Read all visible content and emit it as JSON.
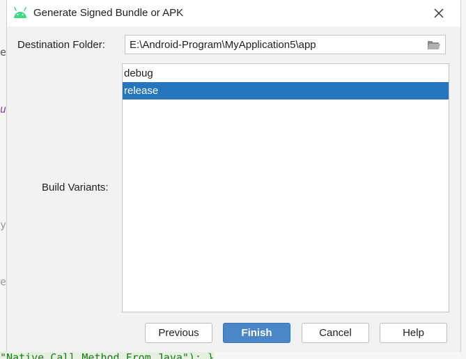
{
  "background": {
    "left_glyphs": [
      "e",
      "u",
      "y",
      "e"
    ],
    "bottom_code": "\"Native Call Method From Java\"); }"
  },
  "dialog": {
    "title": "Generate Signed Bundle or APK",
    "title_icon": "android-icon",
    "close_icon": "close-icon"
  },
  "destination": {
    "label": "Destination Folder:",
    "value": "E:\\Android-Program\\MyApplication5\\app",
    "browse_icon": "folder-icon"
  },
  "build_variants": {
    "label": "Build Variants:",
    "items": [
      {
        "label": "debug",
        "selected": false
      },
      {
        "label": "release",
        "selected": true
      }
    ]
  },
  "buttons": {
    "previous": "Previous",
    "finish": "Finish",
    "cancel": "Cancel",
    "help": "Help"
  },
  "colors": {
    "selection": "#2675bf",
    "primary_button": "#4a86c8",
    "android_green": "#3ddc84"
  }
}
